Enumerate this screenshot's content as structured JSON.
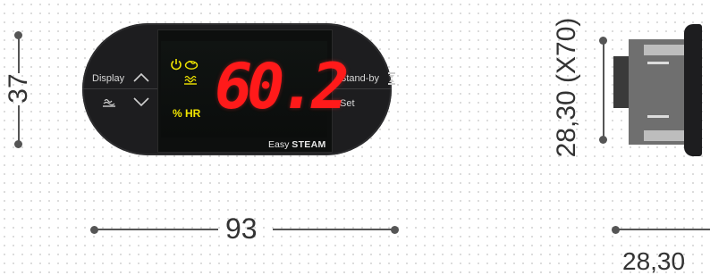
{
  "controller": {
    "display_label": "Display",
    "standby_label": "Stand-by",
    "set_label": "Set",
    "lcd_value": "60.2",
    "unit_label": "% HR",
    "brand_light": "Easy",
    "brand_bold": "STEAM",
    "display_color": "#ff1a1a",
    "indicator_color": "#f2e600"
  },
  "dimensions": {
    "height_label": "37",
    "width_label": "93",
    "side_height_label": "28,30 (X70)",
    "side_width_label": "28,30"
  },
  "icons": [
    "power-icon",
    "steam-icon",
    "humidifier-icon",
    "chevron-up-icon",
    "chevron-down-icon",
    "standby-icon"
  ]
}
